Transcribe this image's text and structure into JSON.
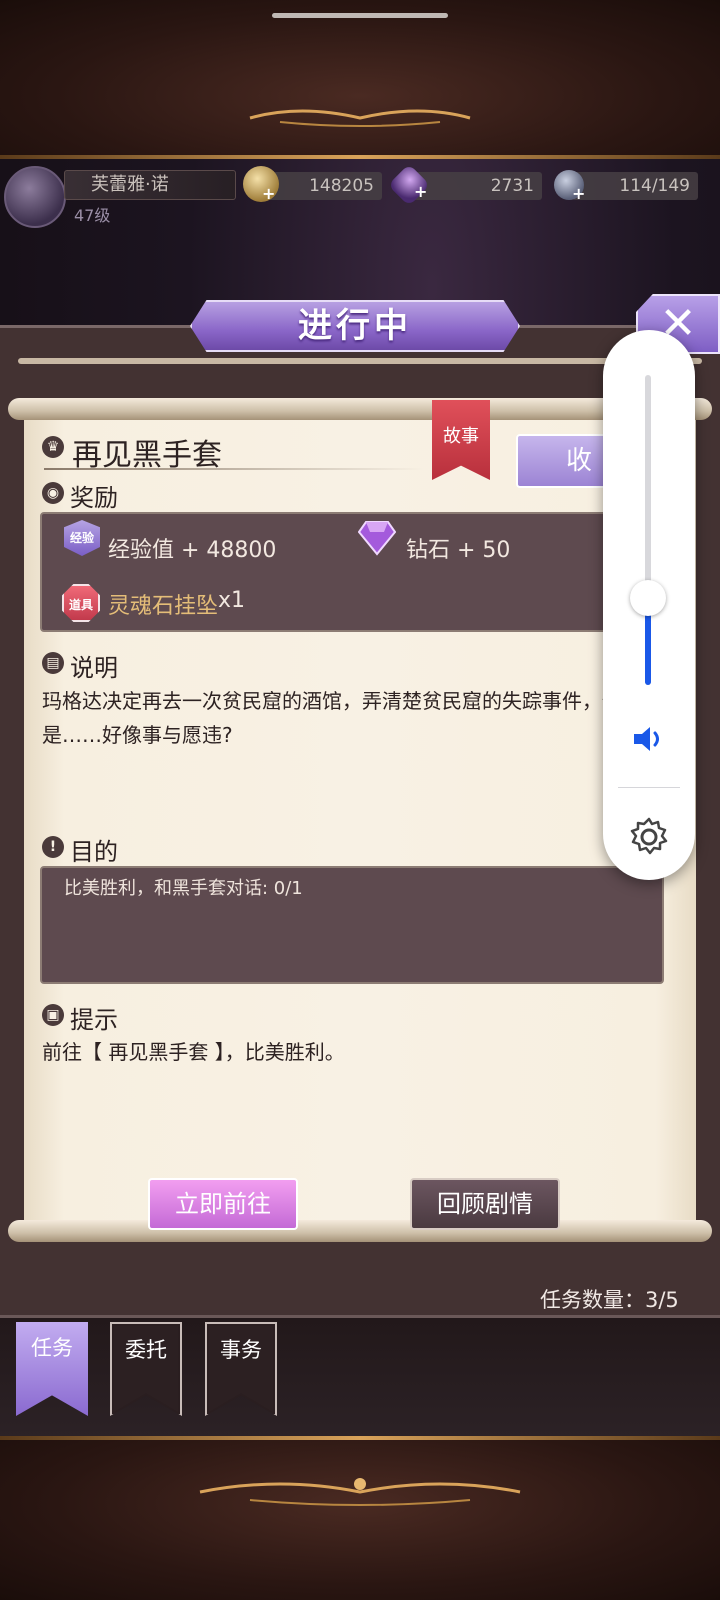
{
  "player": {
    "name": "芙蕾雅·诺",
    "level": "47级"
  },
  "resources": {
    "gold": "148205",
    "diamonds": "2731",
    "stamina": "114/149"
  },
  "panel": {
    "title": "进行中",
    "close_symbol": "✕"
  },
  "quest": {
    "title": "再见黑手套",
    "tag": "故事",
    "collect_label": "收",
    "reward_label": "奖励",
    "rewards": {
      "exp_badge": "经验",
      "exp_text": "经验值 + 48800",
      "diamond_text": "钻石 + 50",
      "item_badge": "道具",
      "item_name": "灵魂石挂坠",
      "item_qty": "x1"
    },
    "desc_label": "说明",
    "description": "玛格达决定再去一次贫民窟的酒馆，弄清楚贫民窟的失踪事件，但是……好像事与愿违?",
    "goal_label": "目的",
    "goal_text": "比美胜利，和黑手套对话: 0/1",
    "hint_label": "提示",
    "hint_text": "前往【 再见黑手套 】，比美胜利。",
    "go_label": "立即前往",
    "review_label": "回顾剧情"
  },
  "task_count": "任务数量：3/5",
  "tabs": [
    {
      "label": "任务",
      "active": true
    },
    {
      "label": "委托",
      "active": false
    },
    {
      "label": "事务",
      "active": false
    }
  ],
  "volume": {
    "level": 0.28,
    "accent": "#1a58e8",
    "icons": [
      "speaker-icon",
      "settings-gear-icon"
    ]
  },
  "colors": {
    "accent_purple": "#8a66c8",
    "parchment": "#f8f1e4",
    "dark_box": "#5e4a4f",
    "tag_red": "#c8343f",
    "go_pink": "#d47ee0"
  }
}
